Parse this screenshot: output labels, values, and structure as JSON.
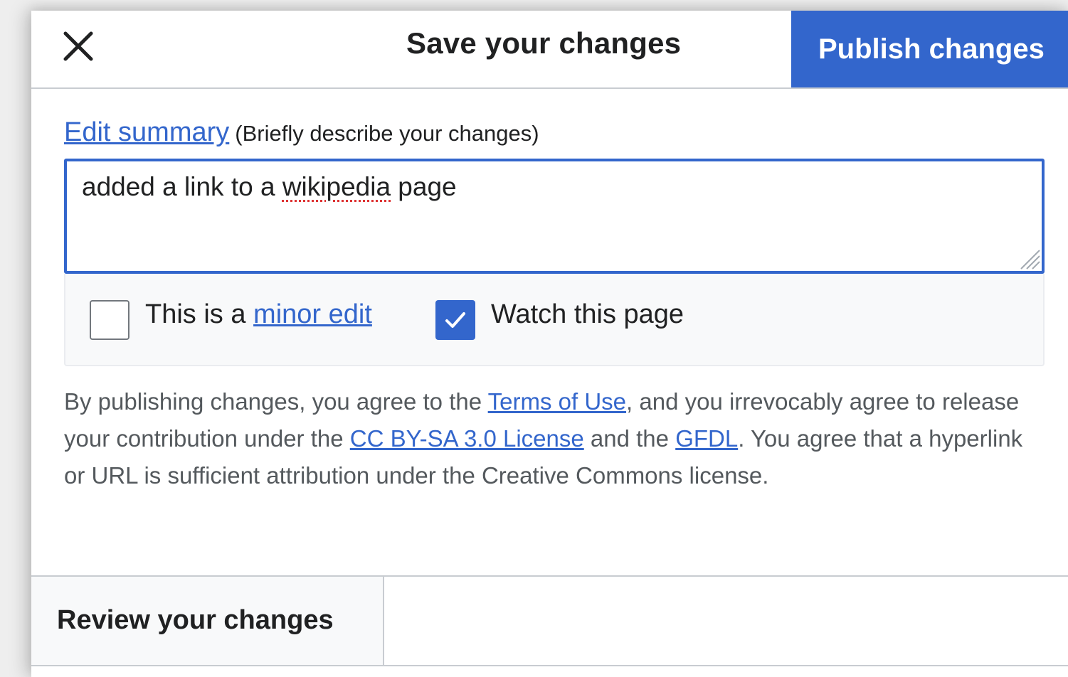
{
  "header": {
    "close_icon": "close-icon",
    "title": "Save your changes",
    "publish_label": "Publish changes"
  },
  "summary": {
    "label_link": "Edit summary",
    "hint": "(Briefly describe your changes)",
    "value_before": "added a link to a ",
    "value_misspelled": "wikipedia",
    "value_after": " page"
  },
  "options": {
    "minor_prefix": "This is a ",
    "minor_link": "minor edit",
    "minor_checked": false,
    "watch_label": "Watch this page",
    "watch_checked": true
  },
  "legal": {
    "part1": "By publishing changes, you agree to the ",
    "terms_link": "Terms of Use",
    "part2": ", and you irrevocably agree to release your contribution under the ",
    "license_link": "CC BY-SA 3.0 License",
    "part3": " and the ",
    "gfdl_link": "GFDL",
    "part4": ". You agree that a hyperlink or URL is sufficient attribution under the Creative Commons license."
  },
  "footer": {
    "review_label": "Review your changes"
  },
  "colors": {
    "accent": "#3366cc",
    "text": "#202122",
    "muted_text": "#54595d",
    "border": "#c8ccd1"
  }
}
